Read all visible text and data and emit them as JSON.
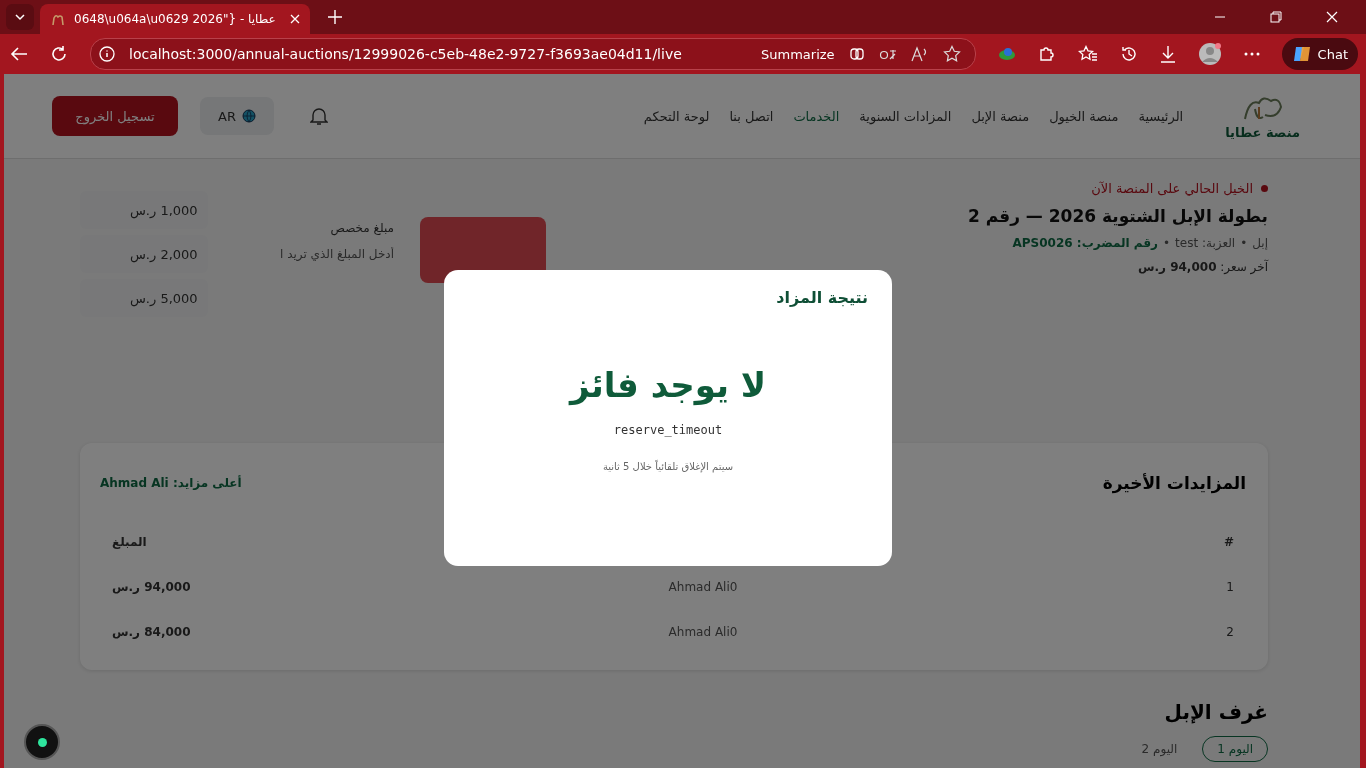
{
  "browser": {
    "tab_title": "0648\\u064a\\u0629 2026\"} - عطايا",
    "url": "localhost:3000/annual-auctions/12999026-c5eb-48e2-9727-f3693ae04d11/live",
    "summarize": "Summarize",
    "chat": "Chat"
  },
  "header": {
    "logo_text": "منصة عطايا",
    "nav": [
      {
        "label": "الرئيسية",
        "selected": false
      },
      {
        "label": "منصة الخيول",
        "selected": false
      },
      {
        "label": "منصة الإبل",
        "selected": false
      },
      {
        "label": "المزادات السنوية",
        "selected": false
      },
      {
        "label": "الخدمات",
        "selected": true
      },
      {
        "label": "اتصل بنا",
        "selected": false
      },
      {
        "label": "لوحة التحكم",
        "selected": false
      }
    ],
    "language": "AR",
    "logout": "تسجيل الخروج"
  },
  "live": {
    "badge": "الخيل الحالي على المنصة الآن",
    "title": "بطولة الإبل الشتوية 2026 — رقم 2",
    "meta": [
      {
        "text": "إبل",
        "kind": "plain"
      },
      {
        "text": "•",
        "kind": "separator"
      },
      {
        "text": "العزبة: test",
        "kind": "plain"
      },
      {
        "text": "•",
        "kind": "separator"
      },
      {
        "text": "رقم المضرب: APS0026",
        "kind": "highlight"
      }
    ],
    "last_price": "آخر سعر: **94,000 ر.س**",
    "custom_label": "مبلغ مخصص",
    "custom_placeholder": "أدخل المبلغ الذي تريد ا",
    "quick_amounts": [
      "1,000 ر.س",
      "2,000 ر.س",
      "5,000 ر.س"
    ]
  },
  "bids": {
    "title": "المزايدات الأخيرة",
    "top_bidder": "أعلى مزايد: Ahmad Ali",
    "columns": [
      "#",
      "المبلغ"
    ],
    "rows": [
      {
        "index": "1",
        "bidder": "Ahmad Ali0",
        "amount": "94,000 ر.س"
      },
      {
        "index": "2",
        "bidder": "Ahmad Ali0",
        "amount": "84,000 ر.س"
      }
    ]
  },
  "rooms": {
    "title": "غرف الإبل",
    "days": [
      {
        "label": "اليوم 1",
        "selected": true
      },
      {
        "label": "اليوم 2",
        "selected": false
      }
    ]
  },
  "modal": {
    "title": "نتيجة المزاد",
    "result": "لا يوجد فائز",
    "reason": "reserve_timeout",
    "countdown": "سيتم الإغلاق تلقائياً خلال 5 ثانية"
  }
}
